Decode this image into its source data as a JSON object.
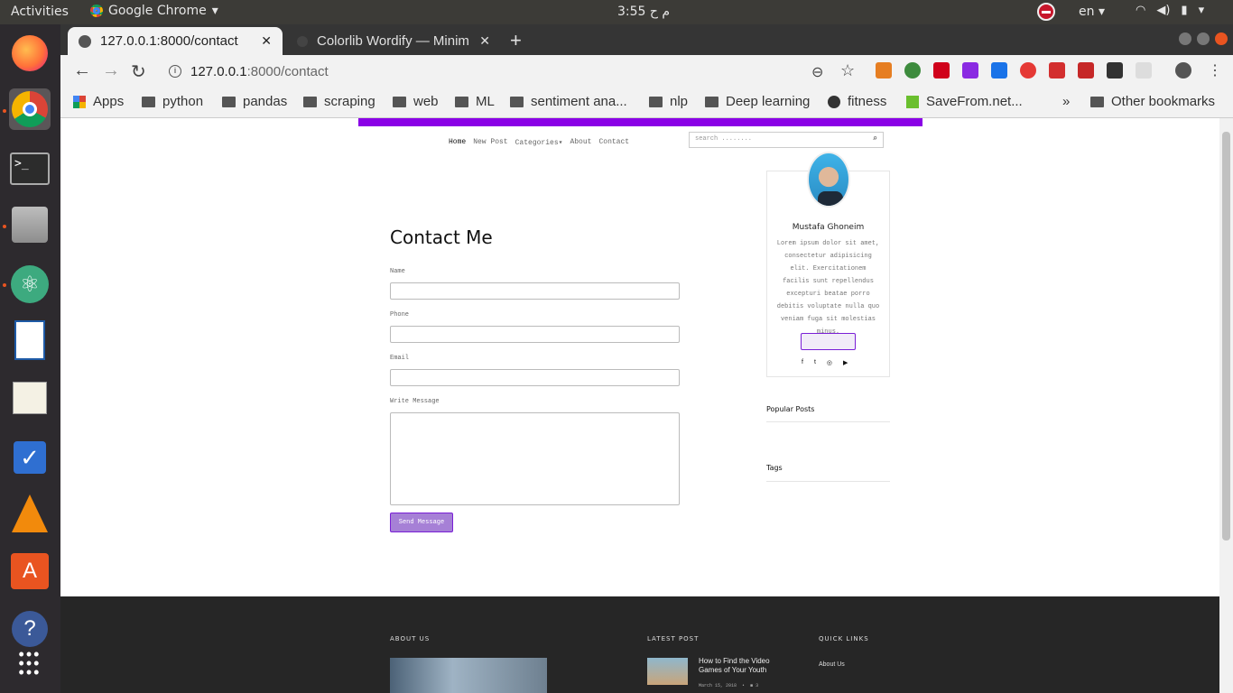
{
  "topbar": {
    "activities": "Activities",
    "app_name": "Google Chrome",
    "clock": "3:55 م ح",
    "lang": "en"
  },
  "dock": {
    "icons": [
      "firefox-icon",
      "chrome-icon",
      "terminal-icon",
      "files-icon",
      "atom-icon",
      "writer-icon",
      "text-editor-icon",
      "todo-icon",
      "vlc-icon",
      "software-center-icon",
      "help-icon",
      "app-grid-icon"
    ]
  },
  "browser": {
    "tabs": [
      {
        "title": "127.0.0.1:8000/contact",
        "active": true
      },
      {
        "title": "Colorlib Wordify — Minim",
        "active": false
      }
    ],
    "url_host": "127.0.0.1",
    "url_rest": ":8000/contact",
    "bookmarks": [
      "Apps",
      "python",
      "pandas",
      "scraping",
      "web",
      "ML",
      "sentiment ana...",
      "nlp",
      "Deep learning",
      "fitness",
      "SaveFrom.net..."
    ],
    "overflow": "»",
    "other_bookmarks": "Other bookmarks"
  },
  "site": {
    "accent": "#8a00e6",
    "nav": [
      "Home",
      "New Post",
      "Categories",
      "About",
      "Contact"
    ],
    "search_placeholder": "search ........",
    "contact": {
      "title": "Contact Me",
      "fields": [
        "Name",
        "Phone",
        "Email"
      ],
      "message_label": "Write Message",
      "send": "Send Message"
    },
    "sidebar": {
      "name": "Mustafa Ghoneim",
      "bio": "Lorem ipsum dolor sit amet, consectetur adipisicing elit. Exercitationem facilis sunt repellendus excepturi beatae porro debitis voluptate nulla quo veniam fuga sit molestias minus.",
      "popular": "Popular Posts",
      "tags": "Tags"
    },
    "footer": {
      "about": "ABOUT US",
      "latest": "LATEST POST",
      "quick": "QUICK LINKS",
      "post_title": "How to Find the Video Games of Your Youth",
      "post_date": "March 15, 2018",
      "post_comments": "3",
      "quick_link": "About Us"
    }
  }
}
